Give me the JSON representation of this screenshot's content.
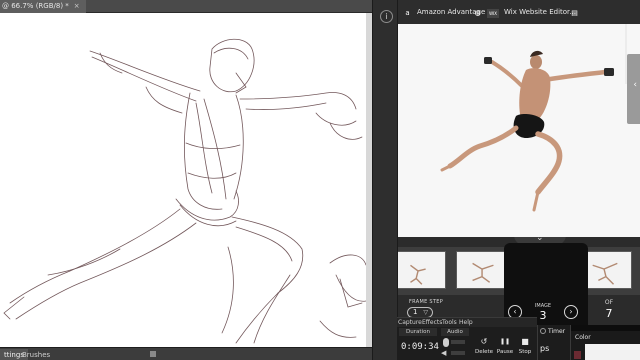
{
  "photoshop": {
    "tab_title": "@ 66.7% (RGB/8) *",
    "tab_close": "×",
    "bottom_tabs": [
      "ttings",
      "Brushes"
    ]
  },
  "middle_strip": {
    "info_button": "i"
  },
  "browser": {
    "bookmarks": [
      {
        "label": "Amazon Advantage",
        "icon": "amazon-icon",
        "glyph": "a"
      },
      {
        "label": "",
        "icon": "globe-icon",
        "glyph": "◍"
      },
      {
        "label": "Wix Website Editor...",
        "icon": "wix-icon",
        "glyph": "WIX"
      },
      {
        "label": "",
        "icon": "page-icon",
        "glyph": "▤"
      }
    ],
    "side_chevron": "‹"
  },
  "reference_app": {
    "collapse_chevron": "⌄",
    "frame_step_label": "FRAME STEP",
    "frame_step_value": "1",
    "image_label": "IMAGE",
    "image_number": "3",
    "of_label": "OF",
    "total_images": "7",
    "prev_glyph": "‹",
    "next_glyph": "›",
    "thumbnails": [
      {
        "id": "thumb-1",
        "active": false
      },
      {
        "id": "thumb-2",
        "active": false
      },
      {
        "id": "thumb-3",
        "active": true
      },
      {
        "id": "thumb-4",
        "active": false
      }
    ]
  },
  "recorder": {
    "menu": [
      "Capture",
      "Effects",
      "Tools",
      "Help"
    ],
    "duration_label": "Duration",
    "audio_label": "Audio",
    "duration_value": "0:09:34",
    "buttons": [
      {
        "label": "Delete",
        "icon": "undo-icon",
        "glyph": "↺"
      },
      {
        "label": "Pause",
        "icon": "pause-icon",
        "glyph": "❚❚"
      },
      {
        "label": "Stop",
        "icon": "stop-icon",
        "glyph": "■"
      }
    ]
  },
  "timer_panel": {
    "label": "Timer",
    "value": "ps"
  },
  "color_panel": {
    "label": "Color",
    "swatch_color": "#6b2a32"
  }
}
